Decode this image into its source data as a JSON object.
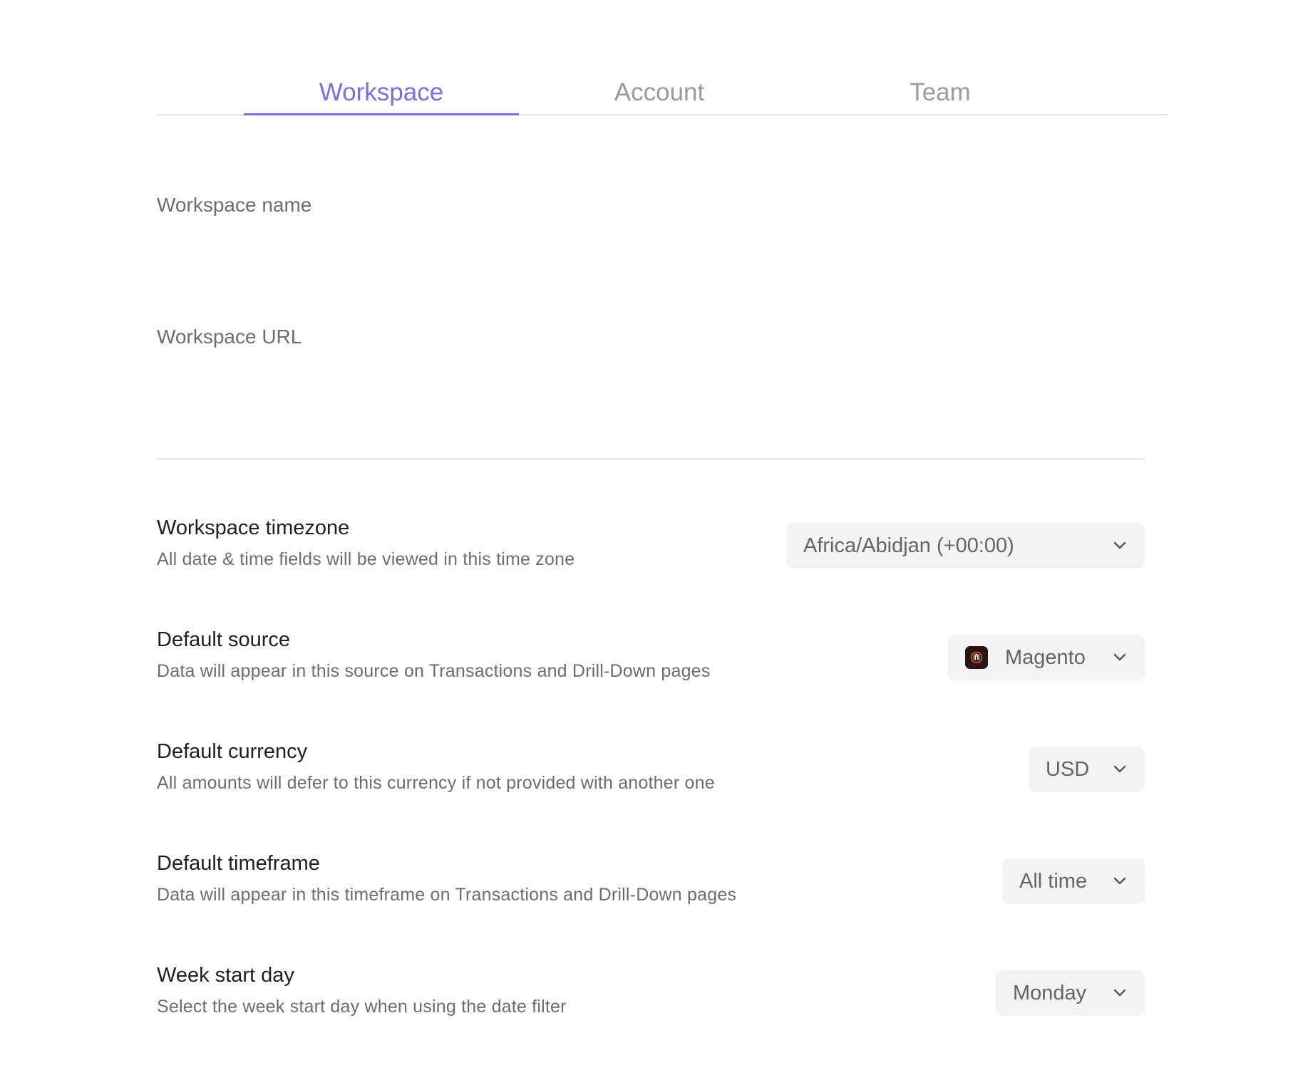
{
  "tabs": {
    "workspace": "Workspace",
    "account": "Account",
    "team": "Team",
    "active": "workspace"
  },
  "form": {
    "workspace_name_label": "Workspace name",
    "workspace_name_value": "",
    "workspace_url_label": "Workspace URL",
    "workspace_url_value": ""
  },
  "settings": {
    "timezone": {
      "title": "Workspace timezone",
      "description": "All date & time fields will be viewed in this time zone",
      "value": "Africa/Abidjan (+00:00)"
    },
    "source": {
      "title": "Default source",
      "description": "Data will appear in this source on Transactions and Drill-Down pages",
      "value": "Magento",
      "icon": "magento-logo-icon"
    },
    "currency": {
      "title": "Default currency",
      "description": "All amounts will defer to this currency if not provided with another one",
      "value": "USD"
    },
    "timeframe": {
      "title": "Default timeframe",
      "description": "Data will appear in this timeframe on Transactions and Drill-Down pages",
      "value": "All time"
    },
    "week_start": {
      "title": "Week start day",
      "description": "Select the week start day when using the date filter",
      "value": "Monday"
    }
  },
  "colors": {
    "accent": "#7b6fdc",
    "muted_text": "#6b6d74",
    "tab_inactive": "#9a9ba1",
    "select_bg": "#f3f3f4",
    "divider": "#e5e5e8",
    "magento_bg": "#2a1510",
    "magento_mark": "#f26322"
  }
}
